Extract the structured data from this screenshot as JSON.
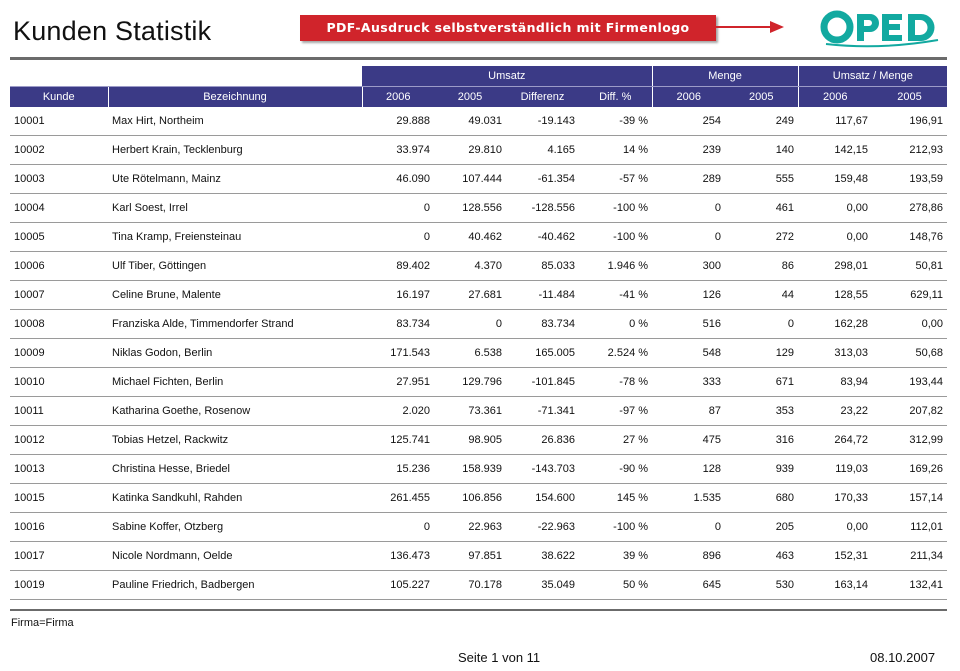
{
  "header": {
    "title": "Kunden Statistik",
    "banner_text": "PDF-Ausdruck selbstverständlich mit Firmenlogo möglich!",
    "logo_text": "OPED",
    "colors": {
      "banner": "#d0242b",
      "table_header": "#3b3a86",
      "logo": "#12a9a0"
    }
  },
  "table": {
    "group_headers": [
      "Umsatz",
      "Menge",
      "Umsatz / Menge"
    ],
    "columns": [
      "Kunde",
      "Bezeichnung",
      "2006",
      "2005",
      "Differenz",
      "Diff. %",
      "2006",
      "2005",
      "2006",
      "2005"
    ],
    "rows": [
      [
        "10001",
        "Max Hirt, Northeim",
        "29.888",
        "49.031",
        "-19.143",
        "-39 %",
        "254",
        "249",
        "117,67",
        "196,91"
      ],
      [
        "10002",
        "Herbert Krain, Tecklenburg",
        "33.974",
        "29.810",
        "4.165",
        "14 %",
        "239",
        "140",
        "142,15",
        "212,93"
      ],
      [
        "10003",
        "Ute Rötelmann, Mainz",
        "46.090",
        "107.444",
        "-61.354",
        "-57 %",
        "289",
        "555",
        "159,48",
        "193,59"
      ],
      [
        "10004",
        "Karl Soest, Irrel",
        "0",
        "128.556",
        "-128.556",
        "-100 %",
        "0",
        "461",
        "0,00",
        "278,86"
      ],
      [
        "10005",
        "Tina Kramp, Freiensteinau",
        "0",
        "40.462",
        "-40.462",
        "-100 %",
        "0",
        "272",
        "0,00",
        "148,76"
      ],
      [
        "10006",
        "Ulf Tiber, Göttingen",
        "89.402",
        "4.370",
        "85.033",
        "1.946 %",
        "300",
        "86",
        "298,01",
        "50,81"
      ],
      [
        "10007",
        "Celine Brune, Malente",
        "16.197",
        "27.681",
        "-11.484",
        "-41 %",
        "126",
        "44",
        "128,55",
        "629,11"
      ],
      [
        "10008",
        "Franziska Alde, Timmendorfer Strand",
        "83.734",
        "0",
        "83.734",
        "0 %",
        "516",
        "0",
        "162,28",
        "0,00"
      ],
      [
        "10009",
        "Niklas Godon, Berlin",
        "171.543",
        "6.538",
        "165.005",
        "2.524 %",
        "548",
        "129",
        "313,03",
        "50,68"
      ],
      [
        "10010",
        "Michael Fichten, Berlin",
        "27.951",
        "129.796",
        "-101.845",
        "-78 %",
        "333",
        "671",
        "83,94",
        "193,44"
      ],
      [
        "10011",
        "Katharina Goethe, Rosenow",
        "2.020",
        "73.361",
        "-71.341",
        "-97 %",
        "87",
        "353",
        "23,22",
        "207,82"
      ],
      [
        "10012",
        "Tobias Hetzel, Rackwitz",
        "125.741",
        "98.905",
        "26.836",
        "27 %",
        "475",
        "316",
        "264,72",
        "312,99"
      ],
      [
        "10013",
        "Christina Hesse, Briedel",
        "15.236",
        "158.939",
        "-143.703",
        "-90 %",
        "128",
        "939",
        "119,03",
        "169,26"
      ],
      [
        "10015",
        "Katinka Sandkuhl, Rahden",
        "261.455",
        "106.856",
        "154.600",
        "145 %",
        "1.535",
        "680",
        "170,33",
        "157,14"
      ],
      [
        "10016",
        "Sabine Koffer, Otzberg",
        "0",
        "22.963",
        "-22.963",
        "-100 %",
        "0",
        "205",
        "0,00",
        "112,01"
      ],
      [
        "10017",
        "Nicole Nordmann, Oelde",
        "136.473",
        "97.851",
        "38.622",
        "39 %",
        "896",
        "463",
        "152,31",
        "211,34"
      ],
      [
        "10019",
        "Pauline Friedrich, Badbergen",
        "105.227",
        "70.178",
        "35.049",
        "50 %",
        "645",
        "530",
        "163,14",
        "132,41"
      ]
    ]
  },
  "footer": {
    "note": "Firma=Firma",
    "pages": "Seite 1 von 11",
    "date": "08.10.2007"
  }
}
